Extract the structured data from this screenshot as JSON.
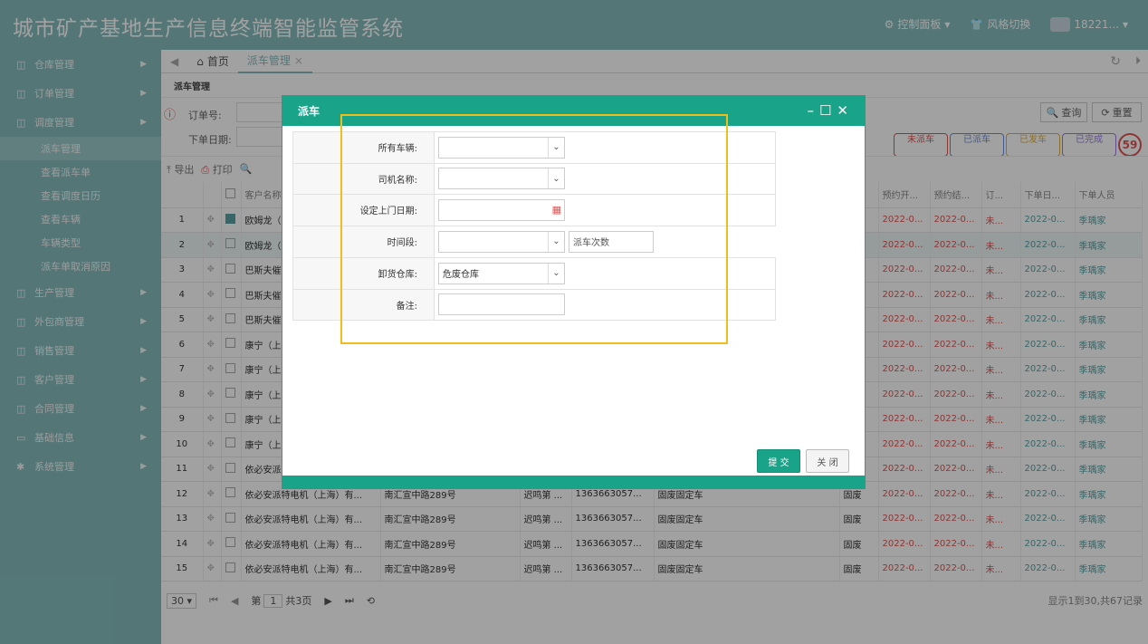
{
  "app": {
    "title": "城市矿产基地生产信息终端智能监管系统"
  },
  "header": {
    "control_panel": "控制面板",
    "style_switch": "风格切换",
    "user": "18221..."
  },
  "sidebar": {
    "items": [
      {
        "label": "仓库管理"
      },
      {
        "label": "订单管理"
      },
      {
        "label": "调度管理"
      }
    ],
    "subitems": [
      {
        "label": "派车管理"
      },
      {
        "label": "查看派车单"
      },
      {
        "label": "查看调度日历"
      },
      {
        "label": "查看车辆"
      },
      {
        "label": "车辆类型"
      },
      {
        "label": "派车单取消原因"
      }
    ],
    "items2": [
      {
        "label": "生产管理"
      },
      {
        "label": "外包商管理"
      },
      {
        "label": "销售管理"
      },
      {
        "label": "客户管理"
      },
      {
        "label": "合同管理"
      },
      {
        "label": "基础信息"
      },
      {
        "label": "系统管理"
      }
    ]
  },
  "tabs": {
    "home": "首页",
    "current": "派车管理"
  },
  "breadcrumb": "派车管理",
  "filter": {
    "order_no_label": "订单号:",
    "order_date_label": "下单日期:",
    "query": "查询",
    "reset": "重置"
  },
  "status": {
    "not_dispatched": "未派车",
    "dispatched": "已派车",
    "shipped": "已发车",
    "done": "已完成",
    "count": "59"
  },
  "toolbar": {
    "export": "导出",
    "print": "打印"
  },
  "table": {
    "headers": [
      "客户名称",
      "预约开...",
      "预约结...",
      "订...",
      "下单日...",
      "下单人员"
    ],
    "rows": [
      {
        "n": "1",
        "name": "欧姆龙（",
        "addr": "",
        "contact": "",
        "phone": "",
        "type": "",
        "cat": "",
        "s": "2022-0...",
        "e": "2022-0...",
        "st": "未...",
        "d": "2022-0...",
        "p": "季瑀家"
      },
      {
        "n": "2",
        "name": "欧姆龙（",
        "addr": "",
        "contact": "",
        "phone": "",
        "type": "",
        "cat": "",
        "s": "2022-0...",
        "e": "2022-0...",
        "st": "未...",
        "d": "2022-0...",
        "p": "季瑀家"
      },
      {
        "n": "3",
        "name": "巴斯夫催",
        "addr": "",
        "contact": "",
        "phone": "",
        "type": "",
        "cat": "",
        "s": "2022-0...",
        "e": "2022-0...",
        "st": "未...",
        "d": "2022-0...",
        "p": "季瑀家"
      },
      {
        "n": "4",
        "name": "巴斯夫催",
        "addr": "",
        "contact": "",
        "phone": "",
        "type": "",
        "cat": "",
        "s": "2022-0...",
        "e": "2022-0...",
        "st": "未...",
        "d": "2022-0...",
        "p": "季瑀家"
      },
      {
        "n": "5",
        "name": "巴斯夫催",
        "addr": "",
        "contact": "",
        "phone": "",
        "type": "",
        "cat": "",
        "s": "2022-0...",
        "e": "2022-0...",
        "st": "未...",
        "d": "2022-0...",
        "p": "季瑀家"
      },
      {
        "n": "6",
        "name": "康宁（上",
        "addr": "",
        "contact": "",
        "phone": "",
        "type": "",
        "cat": "",
        "s": "2022-0...",
        "e": "2022-0...",
        "st": "未...",
        "d": "2022-0...",
        "p": "季瑀家"
      },
      {
        "n": "7",
        "name": "康宁（上",
        "addr": "",
        "contact": "",
        "phone": "",
        "type": "",
        "cat": "",
        "s": "2022-0...",
        "e": "2022-0...",
        "st": "未...",
        "d": "2022-0...",
        "p": "季瑀家"
      },
      {
        "n": "8",
        "name": "康宁（上",
        "addr": "",
        "contact": "",
        "phone": "",
        "type": "",
        "cat": "",
        "s": "2022-0...",
        "e": "2022-0...",
        "st": "未...",
        "d": "2022-0...",
        "p": "季瑀家"
      },
      {
        "n": "9",
        "name": "康宁（上",
        "addr": "",
        "contact": "",
        "phone": "",
        "type": "",
        "cat": "",
        "s": "2022-0...",
        "e": "2022-0...",
        "st": "未...",
        "d": "2022-0...",
        "p": "季瑀家"
      },
      {
        "n": "10",
        "name": "康宁（上",
        "addr": "",
        "contact": "",
        "phone": "",
        "type": "",
        "cat": "",
        "s": "2022-0...",
        "e": "2022-0...",
        "st": "未...",
        "d": "2022-0...",
        "p": "季瑀家"
      },
      {
        "n": "11",
        "name": "依必安派",
        "addr": "",
        "contact": "",
        "phone": "",
        "type": "",
        "cat": "",
        "s": "2022-0...",
        "e": "2022-0...",
        "st": "未...",
        "d": "2022-0...",
        "p": "季瑀家"
      },
      {
        "n": "12",
        "name": "依必安派特电机（上海）有...",
        "addr": "南汇宣中路289号",
        "contact": "迟鸣第 ...",
        "phone": "1363663057...",
        "type": "固废固定车",
        "cat": "固废",
        "s": "2022-0...",
        "e": "2022-0...",
        "st": "未...",
        "d": "2022-0...",
        "p": "季瑀家"
      },
      {
        "n": "13",
        "name": "依必安派特电机（上海）有...",
        "addr": "南汇宣中路289号",
        "contact": "迟鸣第 ...",
        "phone": "1363663057...",
        "type": "固废固定车",
        "cat": "固废",
        "s": "2022-0...",
        "e": "2022-0...",
        "st": "未...",
        "d": "2022-0...",
        "p": "季瑀家"
      },
      {
        "n": "14",
        "name": "依必安派特电机（上海）有...",
        "addr": "南汇宣中路289号",
        "contact": "迟鸣第 ...",
        "phone": "1363663057...",
        "type": "固废固定车",
        "cat": "固废",
        "s": "2022-0...",
        "e": "2022-0...",
        "st": "未...",
        "d": "2022-0...",
        "p": "季瑀家"
      },
      {
        "n": "15",
        "name": "依必安派特电机（上海）有...",
        "addr": "南汇宣中路289号",
        "contact": "迟鸣第 ...",
        "phone": "1363663057...",
        "type": "固废固定车",
        "cat": "固废",
        "s": "2022-0...",
        "e": "2022-0...",
        "st": "未...",
        "d": "2022-0...",
        "p": "季瑀家"
      }
    ]
  },
  "pager": {
    "page_size": "30",
    "page_prefix": "第",
    "page": "1",
    "total_pages": "共3页",
    "summary": "显示1到30,共67记录"
  },
  "dialog": {
    "title": "派车",
    "fields": {
      "vehicle": "所有车辆:",
      "driver": "司机名称:",
      "date": "设定上门日期:",
      "period": "时间段:",
      "trips_placeholder": "派车次数",
      "warehouse": "卸货仓库:",
      "warehouse_value": "危废仓库",
      "remark": "备注:"
    },
    "submit": "提 交",
    "close": "关 闭"
  },
  "colors": {
    "accent": "#19a48a",
    "sidebar": "#85bcbd",
    "highlight": "#f0be1a"
  }
}
